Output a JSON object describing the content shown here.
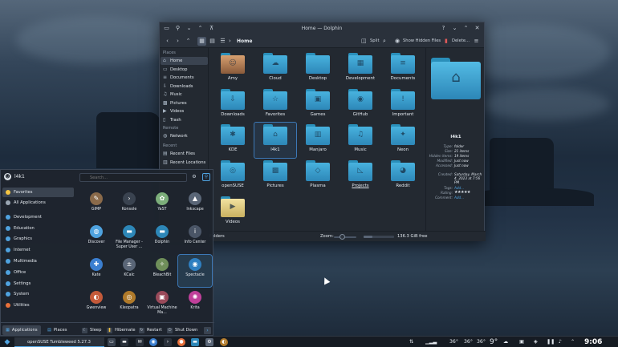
{
  "dolphin": {
    "title": "Home — Dolphin",
    "breadcrumb": "Home",
    "split_label": "Split",
    "hidden_label": "Show Hidden Files",
    "delete_label": "Delete...",
    "sidebar": {
      "places_header": "Places",
      "places": [
        {
          "label": "Home",
          "icon": "home-icon"
        },
        {
          "label": "Desktop",
          "icon": "desktop-icon"
        },
        {
          "label": "Documents",
          "icon": "documents-icon"
        },
        {
          "label": "Downloads",
          "icon": "downloads-icon"
        },
        {
          "label": "Music",
          "icon": "music-icon"
        },
        {
          "label": "Pictures",
          "icon": "pictures-icon"
        },
        {
          "label": "Videos",
          "icon": "videos-icon"
        },
        {
          "label": "Trash",
          "icon": "trash-icon"
        }
      ],
      "remote_header": "Remote",
      "remote": [
        {
          "label": "Network",
          "icon": "network-icon"
        }
      ],
      "recent_header": "Recent",
      "recent": [
        {
          "label": "Recent Files",
          "icon": "recent-files-icon"
        },
        {
          "label": "Recent Locations",
          "icon": "recent-locations-icon"
        }
      ]
    },
    "folders": [
      {
        "name": "Amy",
        "glyph": "☺"
      },
      {
        "name": "Cloud",
        "glyph": "☁"
      },
      {
        "name": "Desktop",
        "glyph": ""
      },
      {
        "name": "Development",
        "glyph": "▦"
      },
      {
        "name": "Documents",
        "glyph": "≡"
      },
      {
        "name": "Downloads",
        "glyph": "⇩"
      },
      {
        "name": "Favorites",
        "glyph": "☆"
      },
      {
        "name": "Games",
        "glyph": "▣"
      },
      {
        "name": "GitHub",
        "glyph": "◉"
      },
      {
        "name": "Important",
        "glyph": "!"
      },
      {
        "name": "KDE",
        "glyph": "✱"
      },
      {
        "name": "l4k1",
        "glyph": "⌂"
      },
      {
        "name": "Manjaro",
        "glyph": "▥"
      },
      {
        "name": "Music",
        "glyph": "♫"
      },
      {
        "name": "Neon",
        "glyph": "✦"
      },
      {
        "name": "openSUSE",
        "glyph": "◎"
      },
      {
        "name": "Pictures",
        "glyph": "▩"
      },
      {
        "name": "Plasma",
        "glyph": "◇"
      },
      {
        "name": "Projects",
        "glyph": "◺"
      },
      {
        "name": "Reddit",
        "glyph": "◕"
      },
      {
        "name": "Videos",
        "glyph": "▶"
      }
    ],
    "info": {
      "name": "l4k1",
      "rows": [
        {
          "key": "Type:",
          "value": "folder"
        },
        {
          "key": "Size:",
          "value": "21 items"
        },
        {
          "key": "Hidden items:",
          "value": "19 items"
        },
        {
          "key": "Modified:",
          "value": "Just now"
        },
        {
          "key": "Accessed:",
          "value": "Just now"
        },
        {
          "key": "Created:",
          "value": "Saturday, March 4, 2023 at 7:56 PM"
        },
        {
          "key": "Tags:",
          "value": "Add..."
        },
        {
          "key": "Rating:",
          "value": "★★★★★"
        },
        {
          "key": "Comment:",
          "value": "Add..."
        }
      ]
    },
    "status": {
      "folders": "Folders",
      "zoom_label": "Zoom:",
      "zoom_level": 0.35,
      "disk_used_fraction": 0.3,
      "free": "136.3 GiB free"
    }
  },
  "kickoff": {
    "user": "l4k1",
    "search_placeholder": "Search...",
    "categories": [
      {
        "label": "Favorites",
        "color": "#f5c542"
      },
      {
        "label": "All Applications",
        "color": "#9aa6b3"
      },
      {
        "label": "Development",
        "color": "#4fa3e0"
      },
      {
        "label": "Education",
        "color": "#4fa3e0"
      },
      {
        "label": "Graphics",
        "color": "#4fa3e0"
      },
      {
        "label": "Internet",
        "color": "#4fa3e0"
      },
      {
        "label": "Multimedia",
        "color": "#4fa3e0"
      },
      {
        "label": "Office",
        "color": "#4fa3e0"
      },
      {
        "label": "Settings",
        "color": "#4fa3e0"
      },
      {
        "label": "System",
        "color": "#4fa3e0"
      },
      {
        "label": "Utilities",
        "color": "#e8703a"
      }
    ],
    "apps": [
      {
        "label": "GIMP",
        "color": "#8a6a4a",
        "glyph": "✎"
      },
      {
        "label": "Konsole",
        "color": "#3a4350",
        "glyph": "›"
      },
      {
        "label": "YaST",
        "color": "#7cae7a",
        "glyph": "✿"
      },
      {
        "label": "Inkscape",
        "color": "#5a6677",
        "glyph": "▲"
      },
      {
        "label": "Discover",
        "color": "#4fa3e0",
        "glyph": "◍"
      },
      {
        "label": "File Manager - Super User ...",
        "color": "#2d87b8",
        "glyph": "▬"
      },
      {
        "label": "Dolphin",
        "color": "#2d87b8",
        "glyph": "▬"
      },
      {
        "label": "Info Center",
        "color": "#4a5566",
        "glyph": "i"
      },
      {
        "label": "Kate",
        "color": "#3b7fd0",
        "glyph": "✚"
      },
      {
        "label": "KCalc",
        "color": "#5a6677",
        "glyph": "±"
      },
      {
        "label": "BleachBit",
        "color": "#6f8f5a",
        "glyph": "✧"
      },
      {
        "label": "Spectacle",
        "color": "#2f7fc0",
        "glyph": "◉"
      },
      {
        "label": "Gwenview",
        "color": "#c45a3a",
        "glyph": "◐"
      },
      {
        "label": "Kleopatra",
        "color": "#b07a2a",
        "glyph": "◎"
      },
      {
        "label": "Virtual Machine Ma...",
        "color": "#9a4a5a",
        "glyph": "▣"
      },
      {
        "label": "Krita",
        "color": "#c0409a",
        "glyph": "✺"
      }
    ],
    "footer": {
      "applications": "Applications",
      "places": "Places",
      "sleep": "Sleep",
      "hibernate": "Hibernate",
      "restart": "Restart",
      "shutdown": "Shut Down"
    }
  },
  "taskbar": {
    "task_title": "openSUSE Tumbleweed 5.27.3",
    "temps": [
      "36°",
      "36°",
      "36°"
    ],
    "weather": "9°",
    "clock": "9:06"
  }
}
